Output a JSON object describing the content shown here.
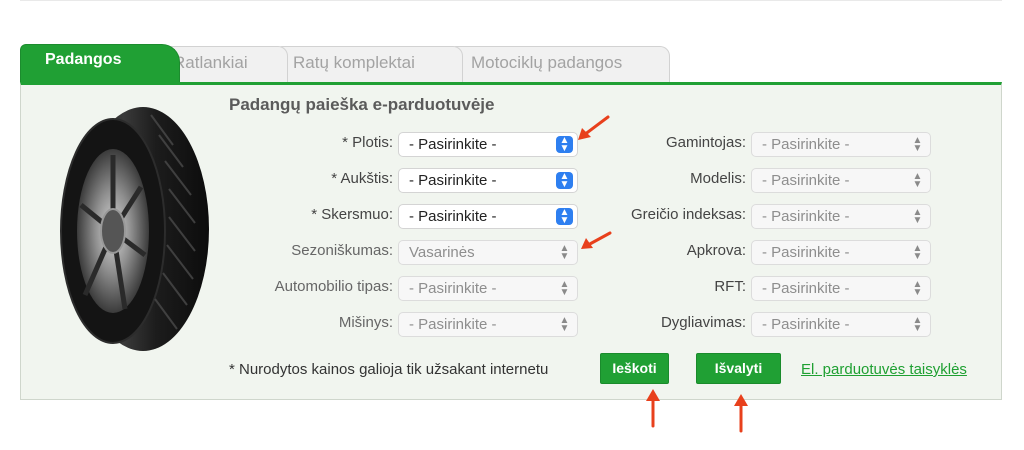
{
  "tabs": [
    {
      "label": "Padangos",
      "active": true
    },
    {
      "label": "Ratlankiai",
      "active": false
    },
    {
      "label": "Ratų komplektai",
      "active": false
    },
    {
      "label": "Motociklų padangos",
      "active": false
    }
  ],
  "panel": {
    "title": "Padangų paieška e-parduotuvėje"
  },
  "left_fields": [
    {
      "label": "* Plotis:",
      "value": "- Pasirinkite -",
      "enabled": true
    },
    {
      "label": "* Aukštis:",
      "value": "- Pasirinkite -",
      "enabled": true
    },
    {
      "label": "* Skersmuo:",
      "value": "- Pasirinkite -",
      "enabled": true
    },
    {
      "label": "Sezoniškumas:",
      "value": "Vasarinės",
      "enabled": false
    },
    {
      "label": "Automobilio tipas:",
      "value": "- Pasirinkite -",
      "enabled": false
    },
    {
      "label": "Mišinys:",
      "value": "- Pasirinkite -",
      "enabled": false
    }
  ],
  "right_fields": [
    {
      "label": "Gamintojas:",
      "value": "- Pasirinkite -",
      "enabled": false
    },
    {
      "label": "Modelis:",
      "value": "- Pasirinkite -",
      "enabled": false
    },
    {
      "label": "Greičio indeksas:",
      "value": "- Pasirinkite -",
      "enabled": false
    },
    {
      "label": "Apkrova:",
      "value": "- Pasirinkite -",
      "enabled": false
    },
    {
      "label": "RFT:",
      "value": "- Pasirinkite -",
      "enabled": false
    },
    {
      "label": "Dygliavimas:",
      "value": "- Pasirinkite -",
      "enabled": false
    }
  ],
  "footer": {
    "note": "* Nurodytos kainos galioja tik užsakant internetu",
    "search_button": "Ieškoti",
    "clear_button": "Išvalyti",
    "rules_link": "El. parduotuvės taisyklės"
  },
  "icons": {
    "tire": "tire-image",
    "select_arrow": "chevron-updown-icon",
    "annotation": "red-arrow-icon"
  },
  "colors": {
    "accent_green": "#20a034",
    "select_blue": "#2e7ff0",
    "annotation_red": "#e8401c"
  }
}
